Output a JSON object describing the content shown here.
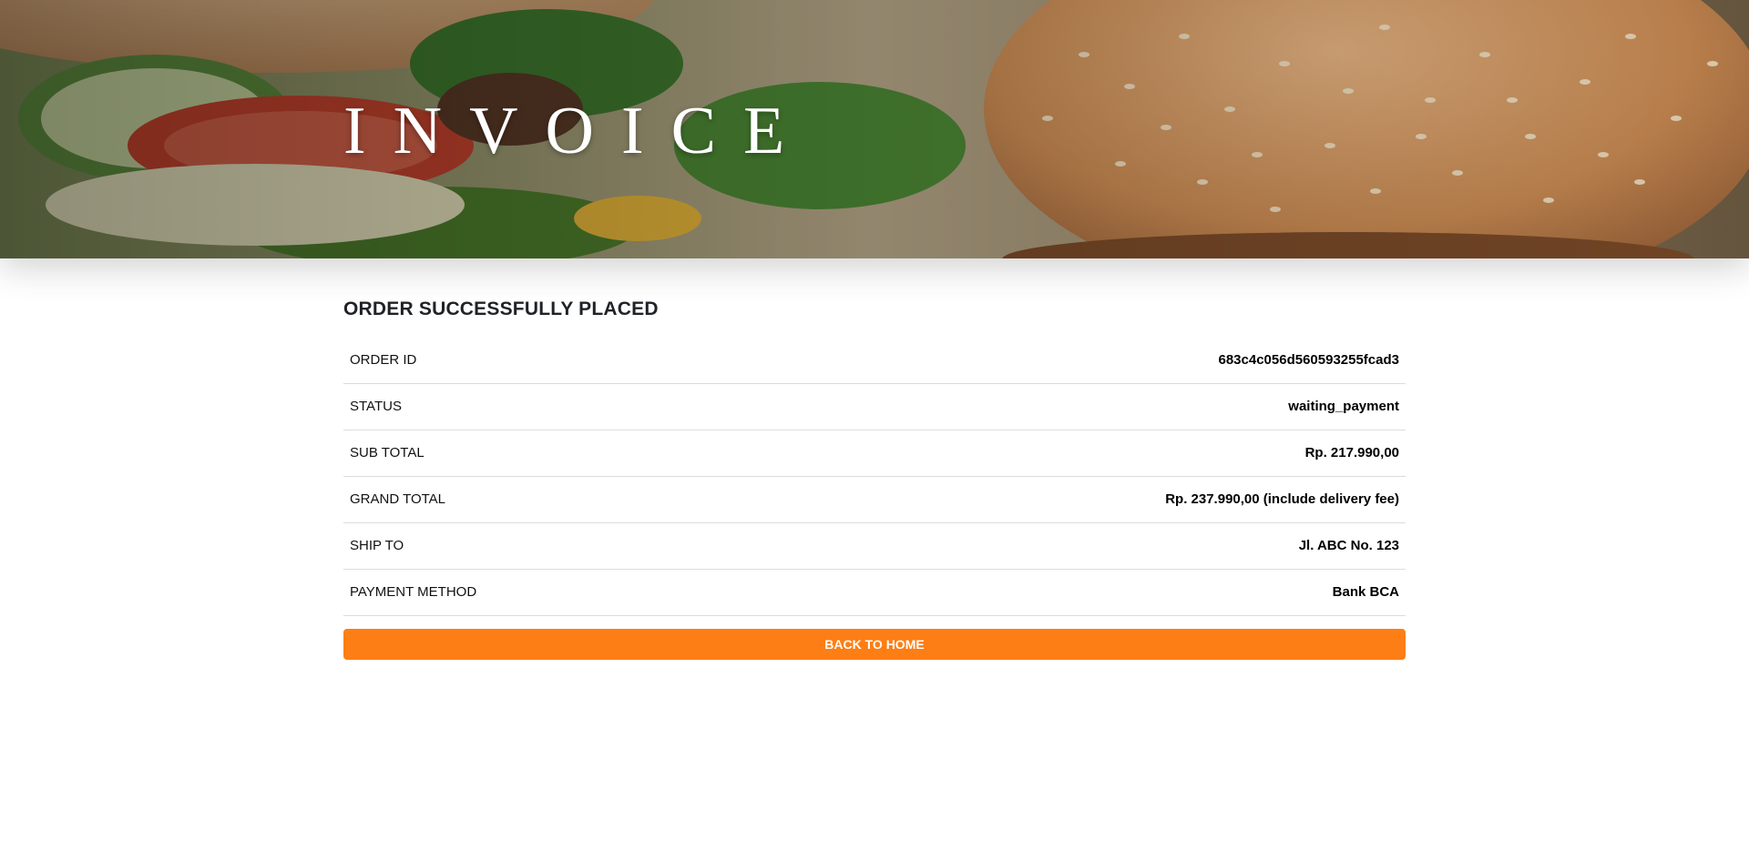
{
  "hero": {
    "title": "INVOICE"
  },
  "main": {
    "heading": "ORDER SUCCESSFULLY PLACED",
    "rows": [
      {
        "label": "ORDER ID",
        "value": "683c4c056d560593255fcad3"
      },
      {
        "label": "STATUS",
        "value": "waiting_payment"
      },
      {
        "label": "SUB TOTAL",
        "value": "Rp. 217.990,00"
      },
      {
        "label": "GRAND TOTAL",
        "value": "Rp. 237.990,00 (include delivery fee)"
      },
      {
        "label": "SHIP TO",
        "value": "Jl. ABC No. 123"
      },
      {
        "label": "PAYMENT METHOD",
        "value": "Bank BCA"
      }
    ],
    "back_button_label": "BACK TO HOME"
  },
  "colors": {
    "accent": "#fd7e14",
    "text": "#1f2328",
    "divider": "#dcdcdc"
  }
}
